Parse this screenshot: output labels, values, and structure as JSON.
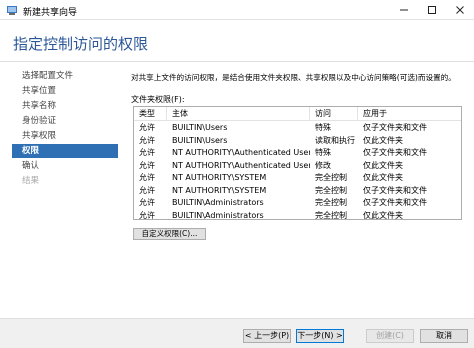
{
  "window": {
    "title": "新建共享向导"
  },
  "header": {
    "title": "指定控制访问的权限"
  },
  "sidebar": {
    "items": [
      {
        "label": "选择配置文件",
        "state": "normal"
      },
      {
        "label": "共享位置",
        "state": "normal"
      },
      {
        "label": "共享名称",
        "state": "normal"
      },
      {
        "label": "身份验证",
        "state": "normal"
      },
      {
        "label": "共享权限",
        "state": "normal"
      },
      {
        "label": "权限",
        "state": "active"
      },
      {
        "label": "确认",
        "state": "normal"
      },
      {
        "label": "结果",
        "state": "disabled"
      }
    ]
  },
  "main": {
    "description": "对共享上文件的访问权限，是结合使用文件夹权限、共享权限以及中心访问策略(可选)而设置的。",
    "folder_perm_label": "文件夹权限(F):",
    "table": {
      "columns": [
        "类型",
        "主体",
        "访问",
        "应用于"
      ],
      "rows": [
        [
          "允许",
          "BUILTIN\\Users",
          "特殊",
          "仅子文件夹和文件"
        ],
        [
          "允许",
          "BUILTIN\\Users",
          "读取和执行",
          "仅此文件夹"
        ],
        [
          "允许",
          "NT AUTHORITY\\Authenticated Users",
          "特殊",
          "仅子文件夹和文件"
        ],
        [
          "允许",
          "NT AUTHORITY\\Authenticated Users",
          "修改",
          "仅此文件夹"
        ],
        [
          "允许",
          "NT AUTHORITY\\SYSTEM",
          "完全控制",
          "仅此文件夹"
        ],
        [
          "允许",
          "NT AUTHORITY\\SYSTEM",
          "完全控制",
          "仅子文件夹和文件"
        ],
        [
          "允许",
          "BUILTIN\\Administrators",
          "完全控制",
          "仅子文件夹和文件"
        ],
        [
          "允许",
          "BUILTIN\\Administrators",
          "完全控制",
          "仅此文件夹"
        ]
      ]
    },
    "custom_button": "自定义权限(C)..."
  },
  "footer": {
    "back": "< 上一步(P)",
    "next": "下一步(N) >",
    "create": "创建(C)",
    "cancel": "取消"
  },
  "colors": {
    "title_blue": "#2b5797",
    "selection": "#2f6fb4"
  }
}
